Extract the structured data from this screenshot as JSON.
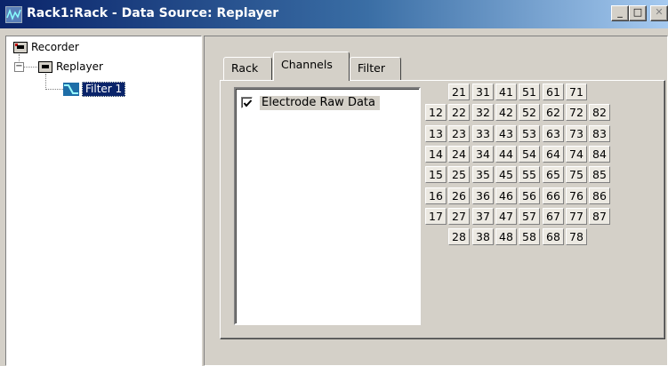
{
  "window": {
    "title": "Rack1:Rack - Data Source: Replayer",
    "buttons": {
      "minimize": "_",
      "maximize": "□",
      "close": "✕"
    }
  },
  "tree": {
    "items": [
      {
        "label": "Recorder",
        "icon": "recorder-device-icon"
      },
      {
        "label": "Replayer",
        "icon": "replayer-device-icon",
        "expander": "−"
      },
      {
        "label": "Filter 1",
        "icon": "filter-icon",
        "selected": true
      }
    ]
  },
  "tabs": [
    {
      "label": "Rack"
    },
    {
      "label": "Channels",
      "active": true
    },
    {
      "label": "Filter"
    }
  ],
  "channels": {
    "items": [
      {
        "label": "Electrode Raw Data",
        "checked": true
      }
    ]
  },
  "electrode_grid": {
    "rows": [
      [
        "",
        "21",
        "31",
        "41",
        "51",
        "61",
        "71",
        ""
      ],
      [
        "12",
        "22",
        "32",
        "42",
        "52",
        "62",
        "72",
        "82"
      ],
      [
        "13",
        "23",
        "33",
        "43",
        "53",
        "63",
        "73",
        "83"
      ],
      [
        "14",
        "24",
        "34",
        "44",
        "54",
        "64",
        "74",
        "84"
      ],
      [
        "15",
        "25",
        "35",
        "45",
        "55",
        "65",
        "75",
        "85"
      ],
      [
        "16",
        "26",
        "36",
        "46",
        "56",
        "66",
        "76",
        "86"
      ],
      [
        "17",
        "27",
        "37",
        "47",
        "57",
        "67",
        "77",
        "87"
      ],
      [
        "",
        "28",
        "38",
        "48",
        "58",
        "68",
        "78",
        ""
      ]
    ]
  },
  "colors": {
    "title_bar": "#0a246a",
    "selection": "#0a246a",
    "face": "#d4d0c8"
  }
}
